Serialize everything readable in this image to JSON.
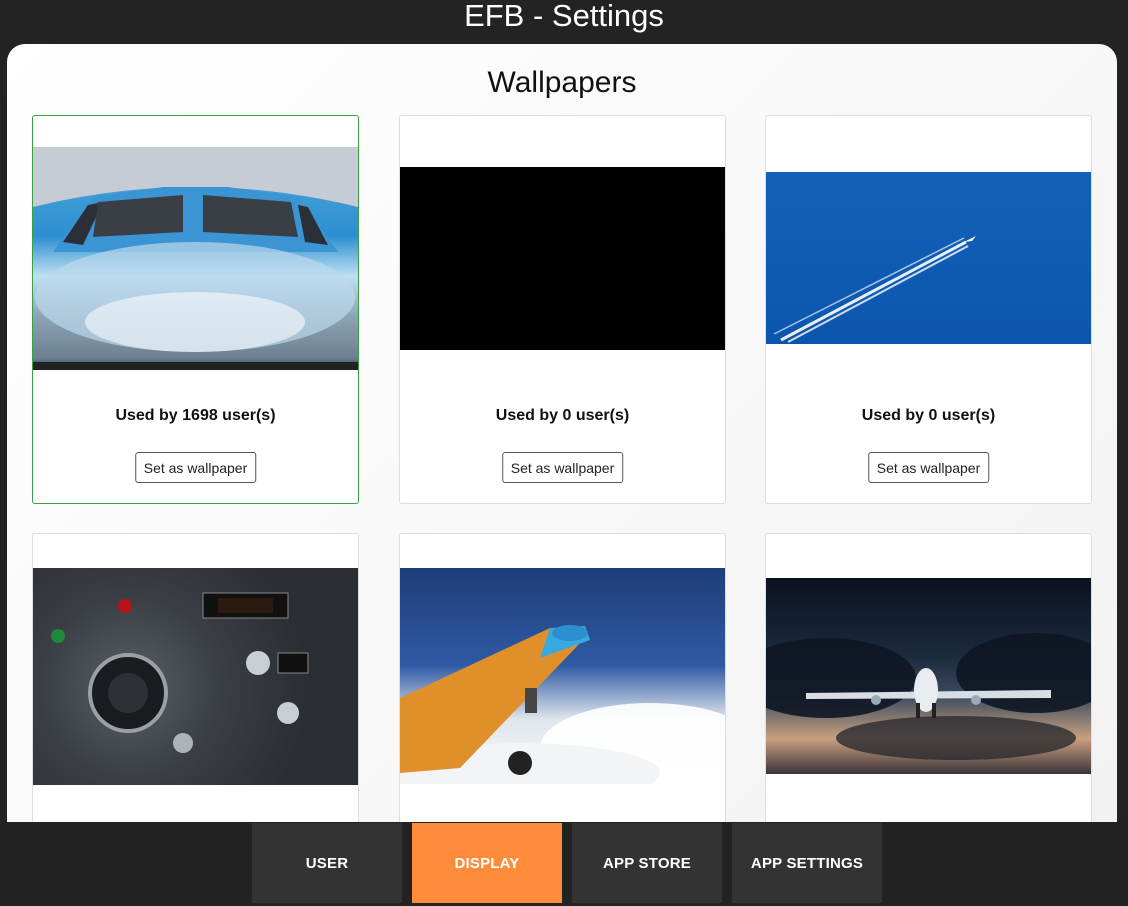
{
  "app": {
    "title": "EFB - Settings"
  },
  "wallpapers": {
    "title": "Wallpapers",
    "items": [
      {
        "image": "airliner-nose-closeup",
        "caption": "Used by 1698 user(s)",
        "button": "Set as wallpaper",
        "selected": true
      },
      {
        "image": "black",
        "caption": "Used by 0 user(s)",
        "button": "Set as wallpaper",
        "selected": false
      },
      {
        "image": "contrail-blue-sky",
        "caption": "Used by 0 user(s)",
        "button": "Set as wallpaper",
        "selected": false
      },
      {
        "image": "cockpit-panel",
        "caption": "",
        "button": "",
        "selected": false
      },
      {
        "image": "painted-737-takeoff",
        "caption": "",
        "button": "",
        "selected": false
      },
      {
        "image": "747-landing-dusk",
        "caption": "",
        "button": "",
        "selected": false
      }
    ]
  },
  "nav": {
    "items": [
      {
        "label": "USER",
        "active": false
      },
      {
        "label": "DISPLAY",
        "active": true
      },
      {
        "label": "APP STORE",
        "active": false
      },
      {
        "label": "APP SETTINGS",
        "active": false
      }
    ]
  },
  "colors": {
    "active_tab": "#ff8c38",
    "selected_border": "#3aa046",
    "background": "#232323"
  }
}
